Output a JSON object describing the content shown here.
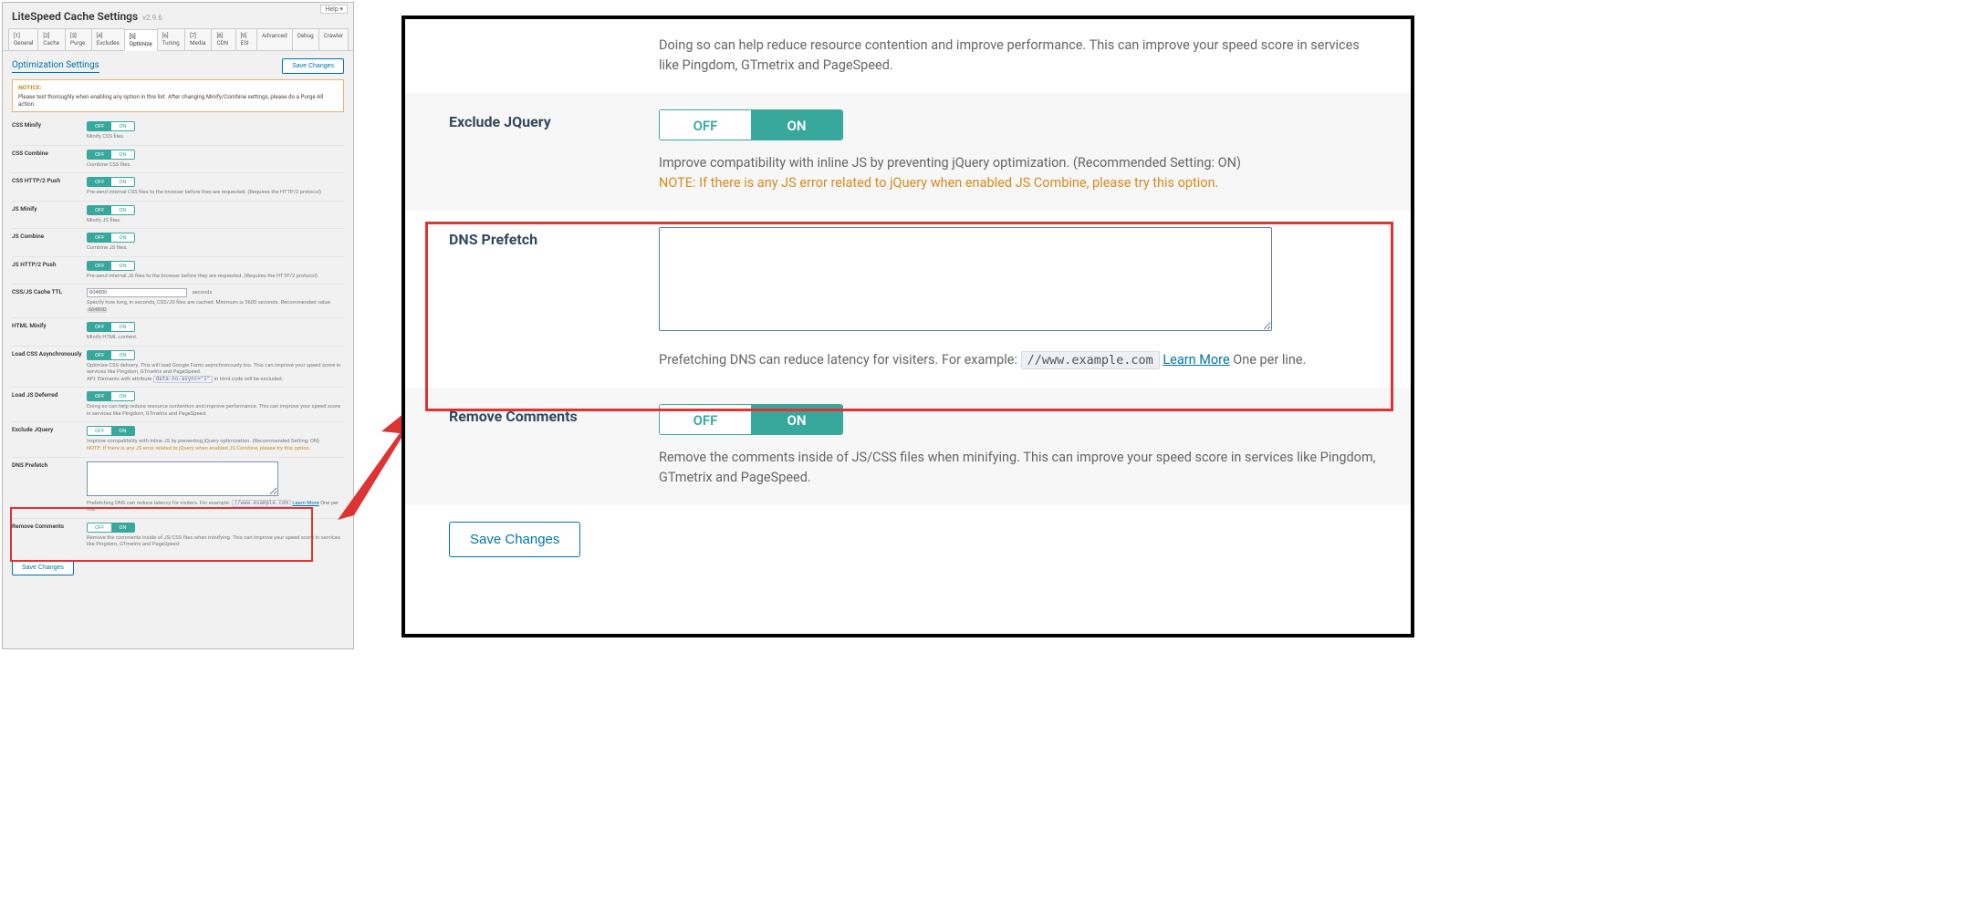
{
  "left": {
    "help": "Help ▾",
    "title": "LiteSpeed Cache Settings",
    "version": "v2.9.6",
    "tabs": [
      "[1] General",
      "[2] Cache",
      "[3] Purge",
      "[4] Excludes",
      "[5] Optimize",
      "[6] Tuning",
      "[7] Media",
      "[8] CDN",
      "[9] ESI",
      "Advanced",
      "Debug",
      "Crawler"
    ],
    "active_tab": 4,
    "section": "Optimization Settings",
    "save": "Save Changes",
    "notice_h": "NOTICE:",
    "notice_t": "Please test thoroughly when enabling any option in this list. After changing Minify/Combine settings, please do a Purge All action.",
    "rows": {
      "css_minify": {
        "label": "CSS Minify",
        "desc": "Minify CSS files."
      },
      "css_combine": {
        "label": "CSS Combine",
        "desc": "Combine CSS files."
      },
      "css_push": {
        "label": "CSS HTTP/2 Push",
        "desc": "Pre-send internal CSS files to the browser before they are requested. (Requires the HTTP/2 protocol)"
      },
      "js_minify": {
        "label": "JS Minify",
        "desc": "Minify JS files."
      },
      "js_combine": {
        "label": "JS Combine",
        "desc": "Combine JS files."
      },
      "js_push": {
        "label": "JS HTTP/2 Push",
        "desc": "Pre-send internal JS files to the browser before they are requested. (Requires the HTTP/2 protocol)"
      },
      "ttl": {
        "label": "CSS/JS Cache TTL",
        "value": "604800",
        "unit": "seconds",
        "desc": "Specify how long, in seconds, CSS/JS files are cached. Minimum is 3600 seconds. Recommended value: ",
        "badge": "604800"
      },
      "html_minify": {
        "label": "HTML Minify",
        "desc": "Minify HTML content."
      },
      "css_async": {
        "label": "Load CSS Asynchronously",
        "desc1": "Optimize CSS delivery. This will load Google Fonts asynchronously too. This can improve your speed score in services like Pingdom, GTmetrix and PageSpeed.",
        "desc2": "API: Elements with attribute ",
        "code": "data-no-async=\"1\"",
        "desc3": " in html code will be excluded."
      },
      "js_defer": {
        "label": "Load JS Deferred",
        "desc": "Doing so can help reduce resource contention and improve performance. This can improve your speed score in services like Pingdom, GTmetrix and PageSpeed."
      },
      "ex_jq": {
        "label": "Exclude JQuery",
        "desc": "Improve compatibility with inline JS by preventing jQuery optimization. (Recommended Setting: ON)",
        "note": "NOTE: If there is any JS error related to jQuery when enabled JS Combine, please try this option."
      },
      "dns": {
        "label": "DNS Prefetch",
        "desc": "Prefetching DNS can reduce latency for visiters. For example: ",
        "code": "//www.example.com",
        "link": "Learn More",
        "tail": " One per line."
      },
      "rm_comments": {
        "label": "Remove Comments",
        "desc": "Remove the comments inside of JS/CSS files when minifying. This can improve your speed score in services like Pingdom, GTmetrix and PageSpeed."
      }
    },
    "off": "OFF",
    "on": "ON"
  },
  "right": {
    "top_desc": "Doing so can help reduce resource contention and improve performance. This can improve your speed score in services like Pingdom, GTmetrix and PageSpeed.",
    "ex_jq_label": "Exclude JQuery",
    "ex_jq_desc": "Improve compatibility with inline JS by preventing jQuery optimization. (Recommended Setting: ON)",
    "ex_jq_note": "NOTE: If there is any JS error related to jQuery when enabled JS Combine, please try this option.",
    "dns_label": "DNS Prefetch",
    "dns_desc": "Prefetching DNS can reduce latency for visiters. For example: ",
    "dns_code": "//www.example.com",
    "dns_link": "Learn More",
    "dns_tail": " One per line.",
    "rm_label": "Remove Comments",
    "rm_desc": "Remove the comments inside of JS/CSS files when minifying. This can improve your speed score in services like Pingdom, GTmetrix and PageSpeed.",
    "save": "Save Changes",
    "off": "OFF",
    "on": "ON"
  }
}
